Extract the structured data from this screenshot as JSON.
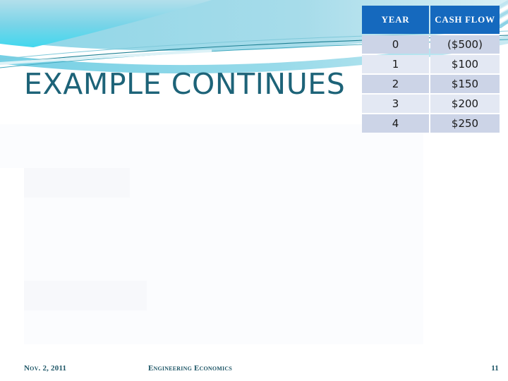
{
  "slide": {
    "title": "EXAMPLE CONTINUES",
    "title_color": "#1d6378",
    "background_color": "#ffffff"
  },
  "decor": {
    "name": "header-swoosh-graphic",
    "gradient_top_color": "#a9dbe8",
    "gradient_bottom_color": "#3ed8ef",
    "band_color": "#7ccfe3",
    "line_color": "#1d7f92",
    "accent_color": "#5bb8d4"
  },
  "table": {
    "name": "cash-flow-table",
    "header_background": "#1569be",
    "header_text_color": "#ffffff",
    "row_odd_background": "#ccd4e7",
    "row_even_background": "#e3e8f3",
    "columns": [
      "YEAR",
      "CASH FLOW"
    ],
    "rows": [
      {
        "year": "0",
        "cash_flow": "($500)"
      },
      {
        "year": "1",
        "cash_flow": "$100"
      },
      {
        "year": "2",
        "cash_flow": "$150"
      },
      {
        "year": "3",
        "cash_flow": "$200"
      },
      {
        "year": "4",
        "cash_flow": "$250"
      }
    ]
  },
  "footer": {
    "date": "Nov. 2, 2011",
    "topic": "Engineering Economics",
    "page_number": "11",
    "text_color": "#1d5566"
  }
}
